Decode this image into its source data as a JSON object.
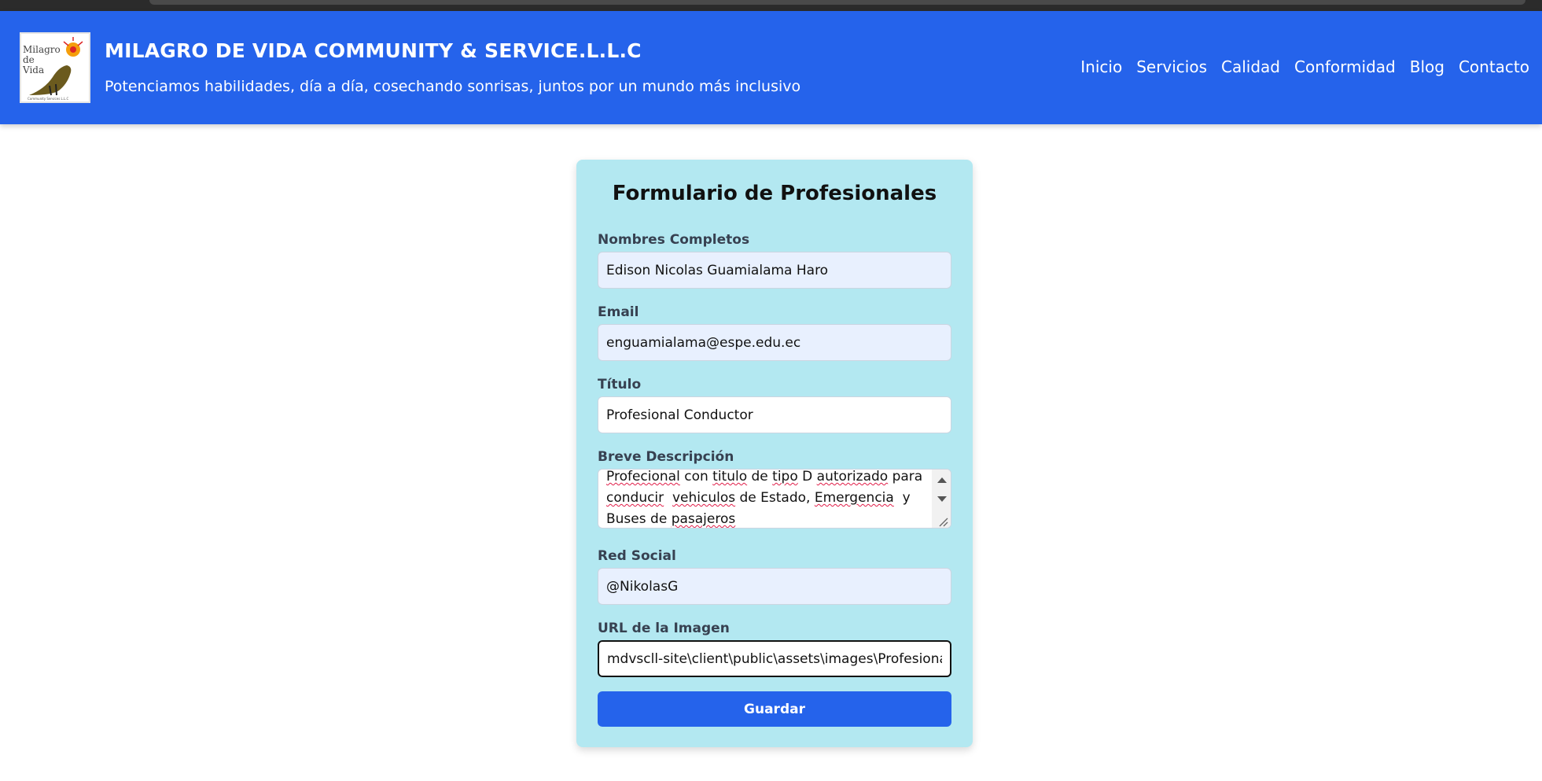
{
  "header": {
    "logo_alt": "Milagro de Vida Community Service L.L.C",
    "title": "MILAGRO DE VIDA COMMUNITY & SERVICE.L.L.C",
    "subtitle": "Potenciamos habilidades, día a día, cosechando sonrisas, juntos por un mundo más inclusivo",
    "nav": [
      "Inicio",
      "Servicios",
      "Calidad",
      "Conformidad",
      "Blog",
      "Contacto"
    ]
  },
  "form": {
    "title": "Formulario de Profesionales",
    "fields": {
      "nombres": {
        "label": "Nombres Completos",
        "value": "Edison Nicolas Guamialama Haro"
      },
      "email": {
        "label": "Email",
        "value": "enguamialama@espe.edu.ec"
      },
      "titulo": {
        "label": "Título",
        "value": "Profesional Conductor"
      },
      "descripcion": {
        "label": "Breve Descripción",
        "lines": [
          "Profecional con titulo de tipo D autorizado para",
          "conducir  vehiculos de Estado, Emergencia  y",
          "Buses de pasajeros"
        ]
      },
      "red_social": {
        "label": "Red Social",
        "value": "@NikolasG"
      },
      "url_imagen": {
        "label": "URL de la Imagen",
        "value": "mdvscll-site\\client\\public\\assets\\images\\Profesionales\\"
      }
    },
    "submit_label": "Guardar"
  },
  "colors": {
    "header_bg": "#2563eb",
    "card_bg": "#b3e8f1",
    "button_bg": "#2563eb"
  }
}
